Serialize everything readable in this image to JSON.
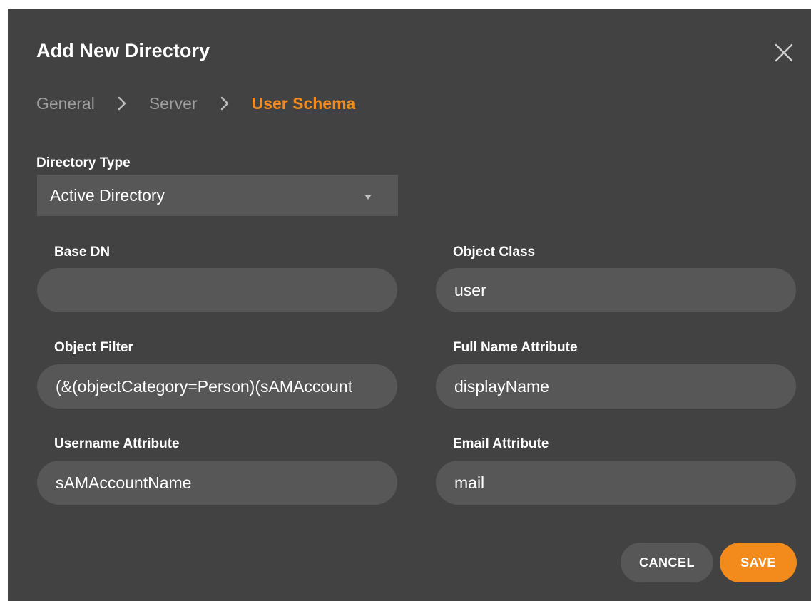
{
  "dialog": {
    "title": "Add New Directory"
  },
  "icons": {
    "close": "close-icon",
    "breadcrumb_separator": "chevron-right-icon",
    "dropdown": "caret-down-icon"
  },
  "breadcrumb": {
    "steps": [
      "General",
      "Server",
      "User Schema"
    ],
    "active_index": 2
  },
  "form": {
    "directory_type": {
      "label": "Directory Type",
      "value": "Active Directory"
    },
    "base_dn": {
      "label": "Base DN",
      "value": ""
    },
    "object_class": {
      "label": "Object Class",
      "value": "user"
    },
    "object_filter": {
      "label": "Object Filter",
      "value": "(&(objectCategory=Person)(sAMAccount"
    },
    "full_name_attribute": {
      "label": "Full Name Attribute",
      "value": "displayName"
    },
    "username_attribute": {
      "label": "Username Attribute",
      "value": "sAMAccountName"
    },
    "email_attribute": {
      "label": "Email Attribute",
      "value": "mail"
    }
  },
  "actions": {
    "cancel_label": "CANCEL",
    "save_label": "SAVE"
  },
  "colors": {
    "background": "#424242",
    "field": "#575757",
    "accent": "#f28a1c",
    "muted_text": "#9e9e9e",
    "text": "#ffffff"
  }
}
